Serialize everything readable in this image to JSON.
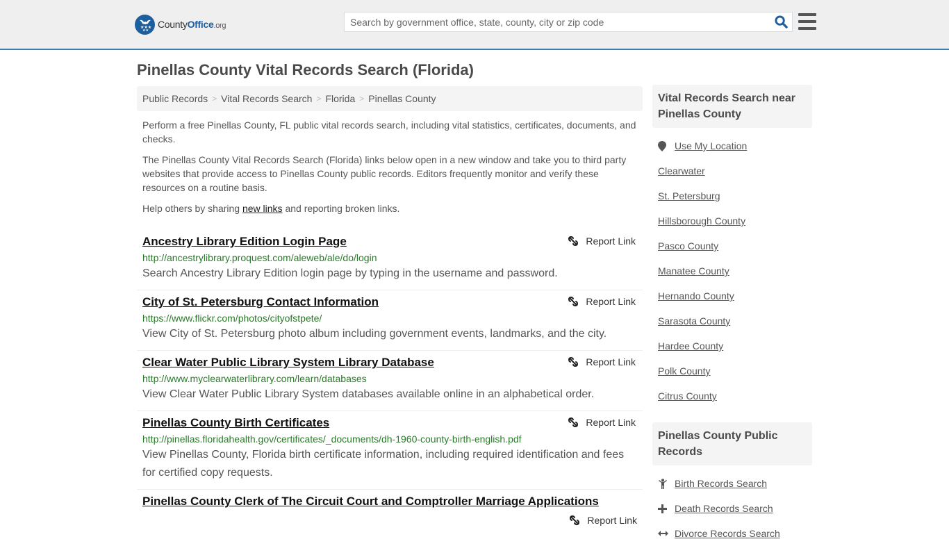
{
  "header": {
    "logo": {
      "county": "County",
      "office": "Office",
      "org": ".org"
    },
    "search_placeholder": "Search by government office, state, county, city or zip code",
    "search_icon": "search-icon",
    "menu_icon": "hamburger-menu-icon"
  },
  "page_title": "Pinellas County Vital Records Search (Florida)",
  "breadcrumb": [
    "Public Records",
    "Vital Records Search",
    "Florida",
    "Pinellas County"
  ],
  "intro": {
    "p1": "Perform a free Pinellas County, FL public vital records search, including vital statistics, certificates, documents, and checks.",
    "p2": "The Pinellas County Vital Records Search (Florida) links below open in a new window and take you to third party websites that provide access to Pinellas County public records. Editors frequently monitor and verify these resources on a routine basis.",
    "p3_before": "Help others by sharing ",
    "p3_link": "new links",
    "p3_after": " and reporting broken links."
  },
  "report_label": "Report Link",
  "results": [
    {
      "title": "Ancestry Library Edition Login Page",
      "url": "http://ancestrylibrary.proquest.com/aleweb/ale/do/login",
      "desc": "Search Ancestry Library Edition login page by typing in the username and password."
    },
    {
      "title": "City of St. Petersburg Contact Information",
      "url": "https://www.flickr.com/photos/cityofstpete/",
      "desc": "View City of St. Petersburg photo album including government events, landmarks, and the city."
    },
    {
      "title": "Clear Water Public Library System Library Database",
      "url": "http://www.myclearwaterlibrary.com/learn/databases",
      "desc": "View Clear Water Public Library System databases available online in an alphabetical order."
    },
    {
      "title": "Pinellas County Birth Certificates",
      "url": "http://pinellas.floridahealth.gov/certificates/_documents/dh-1960-county-birth-english.pdf",
      "desc": "View Pinellas County, Florida birth certificate information, including required identification and fees for certified copy requests."
    },
    {
      "title": "Pinellas County Clerk of The Circuit Court and Comptroller Marriage Applications"
    }
  ],
  "sidebar": {
    "nearby_heading": "Vital Records Search near Pinellas County",
    "use_location": "Use My Location",
    "nearby": [
      "Clearwater",
      "St. Petersburg",
      "Hillsborough County",
      "Pasco County",
      "Manatee County",
      "Hernando County",
      "Sarasota County",
      "Hardee County",
      "Polk County",
      "Citrus County"
    ],
    "public_heading": "Pinellas County Public Records",
    "public_records": [
      {
        "label": "Birth Records Search",
        "icon": "child-icon"
      },
      {
        "label": "Death Records Search",
        "icon": "cross-icon"
      },
      {
        "label": "Divorce Records Search",
        "icon": "arrows-horizontal-icon"
      }
    ]
  },
  "colors": {
    "brand_blue": "#1d5e9e",
    "header_border": "#3b7fae",
    "url_green": "#2a7a2a"
  }
}
